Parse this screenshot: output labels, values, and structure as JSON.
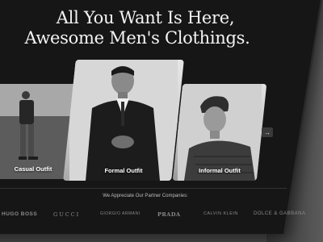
{
  "hero": {
    "headline_line1": "All You Want Is Here,",
    "headline_line2": "Awesome Men's Clothings."
  },
  "categories": [
    {
      "label": "Casual Outfit"
    },
    {
      "label": "Formal Outfit"
    },
    {
      "label": "Informal Outfit"
    }
  ],
  "carousel": {
    "next_icon": "→"
  },
  "partners": {
    "title": "We Appreciate Our Partner Companies:",
    "logos": [
      "HUGO BOSS",
      "GUCCI",
      "GIORGIO ARMANI",
      "PRADA",
      "CALVIN KLEIN",
      "DOLCE & GABBANA"
    ]
  },
  "theme": {
    "background": "#161616",
    "text": "#f4f4f4",
    "muted": "#8a8a8a"
  }
}
